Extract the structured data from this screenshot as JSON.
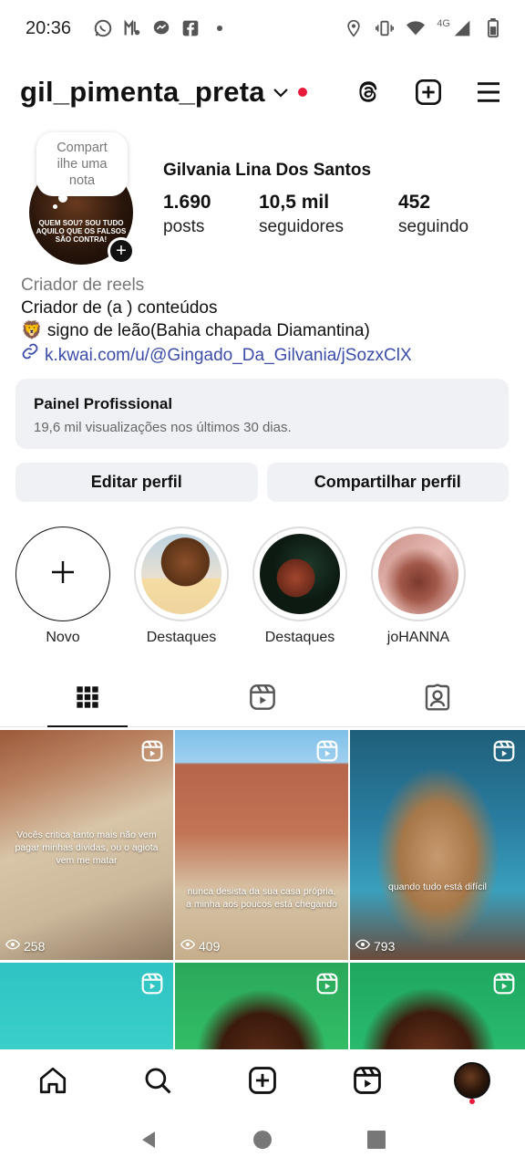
{
  "status_bar": {
    "time": "20:36",
    "network_label": "4G",
    "left_icons": [
      "whatsapp-icon",
      "music-icon",
      "messenger-icon",
      "facebook-icon",
      "dot-icon"
    ],
    "right_icons": [
      "location-icon",
      "vibrate-icon",
      "wifi-icon",
      "signal-icon",
      "battery-icon"
    ]
  },
  "header": {
    "username": "gil_pimenta_preta",
    "has_notification_dot": true,
    "actions": [
      "threads-icon",
      "new-post-icon",
      "menu-icon"
    ]
  },
  "profile": {
    "note_placeholder": "Compart ilhe uma nota",
    "avatar_caption": "QUEM SOU? SOU TUDO AQUILO QUE OS FALSOS SÃO CONTRA!",
    "full_name": "Gilvania Lina Dos Santos",
    "stats": [
      {
        "value": "1.690",
        "label": "posts"
      },
      {
        "value": "10,5 mil",
        "label": "seguidores"
      },
      {
        "value": "452",
        "label": "seguindo"
      }
    ],
    "category": "Criador de reels",
    "bio_lines": [
      "Criador de  (a ) conteúdos",
      "🦁 signo de leão(Bahia chapada Diamantina)"
    ],
    "link": "k.kwai.com/u/@Gingado_Da_Gilvania/jSozxClX"
  },
  "dashboard": {
    "title": "Painel Profissional",
    "subtitle": "19,6 mil visualizações nos últimos 30 dias."
  },
  "buttons": {
    "edit": "Editar perfil",
    "share": "Compartilhar perfil"
  },
  "highlights": [
    {
      "label": "Novo",
      "type": "new"
    },
    {
      "label": "Destaques",
      "type": "story"
    },
    {
      "label": "Destaques",
      "type": "story"
    },
    {
      "label": "joHANNA",
      "type": "story"
    }
  ],
  "tabs": [
    "grid-icon",
    "reels-icon",
    "tagged-icon"
  ],
  "grid": [
    {
      "views": "258",
      "caption": "Vocês critica tanto mais não vem pagar minhas dividas, ou o agiota vem me matar",
      "is_reel": true
    },
    {
      "views": "409",
      "caption": "nunca desista da sua casa própria, a minha aos poucos está chegando",
      "is_reel": true
    },
    {
      "views": "793",
      "caption": "quando tudo está difícil",
      "is_reel": true
    },
    {
      "views": "",
      "caption": "",
      "is_reel": true
    },
    {
      "views": "",
      "caption": "",
      "is_reel": true
    },
    {
      "views": "",
      "caption": "",
      "is_reel": true
    }
  ],
  "bottom_nav": [
    "home-icon",
    "search-icon",
    "create-icon",
    "reels-icon",
    "profile-avatar"
  ],
  "system_nav": [
    "back-icon",
    "home-circle-icon",
    "recents-icon"
  ]
}
